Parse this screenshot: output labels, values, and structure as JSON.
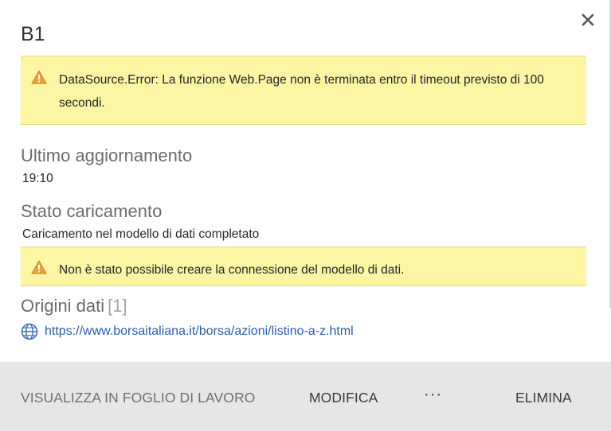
{
  "panel": {
    "title": "B1",
    "close_icon": "close-icon"
  },
  "error_banner": {
    "icon": "warning-icon",
    "message": "DataSource.Error: La funzione Web.Page non è terminata entro il timeout previsto di 100 secondi."
  },
  "last_update": {
    "heading": "Ultimo aggiornamento",
    "value": "19:10"
  },
  "load_status": {
    "heading": "Stato caricamento",
    "value": "Caricamento nel modello di dati completato"
  },
  "model_banner": {
    "icon": "warning-icon",
    "message": "Non è stato possibile creare la connessione del modello di dati."
  },
  "data_sources": {
    "heading": "Origini dati",
    "count": "[1]",
    "items": [
      {
        "icon": "globe-icon",
        "url": "https://www.borsaitaliana.it/borsa/azioni/listino-a-z.html"
      }
    ]
  },
  "footer": {
    "view_label": "VISUALIZZA IN FOGLIO DI LAVORO",
    "edit_label": "MODIFICA",
    "more_label": "···",
    "delete_label": "ELIMINA"
  },
  "colors": {
    "banner_bg": "#fbf5a4",
    "link": "#2a5da8",
    "footer_bg": "#e6e6e6"
  }
}
